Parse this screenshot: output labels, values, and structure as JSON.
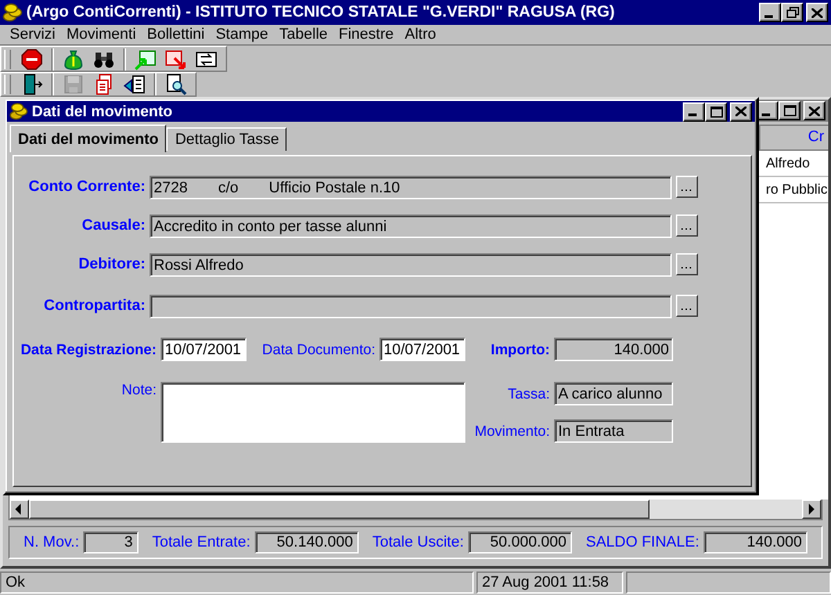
{
  "app_window": {
    "title": "(Argo ContiCorrenti) - ISTITUTO TECNICO STATALE \"G.VERDI\" RAGUSA (RG)"
  },
  "menu": [
    {
      "label": "Servizi"
    },
    {
      "label": "Movimenti"
    },
    {
      "label": "Bollettini"
    },
    {
      "label": "Stampe"
    },
    {
      "label": "Tabelle"
    },
    {
      "label": "Finestre"
    },
    {
      "label": "Altro"
    }
  ],
  "toolbars": [
    {
      "groups": [
        [
          {
            "kind": "stop",
            "disabled": false
          }
        ],
        [
          {
            "kind": "money",
            "disabled": false
          },
          {
            "kind": "binoculars",
            "disabled": false
          }
        ],
        [
          {
            "kind": "import",
            "disabled": false
          },
          {
            "kind": "export",
            "disabled": false
          },
          {
            "kind": "transfer",
            "disabled": false
          }
        ]
      ]
    },
    {
      "groups": [
        [
          {
            "kind": "exit",
            "disabled": false
          }
        ],
        [
          {
            "kind": "save",
            "disabled": true
          },
          {
            "kind": "stack",
            "disabled": false
          },
          {
            "kind": "sendpage",
            "disabled": false
          }
        ],
        [
          {
            "kind": "preview",
            "disabled": false
          }
        ]
      ]
    }
  ],
  "back_window": {
    "header": "Cr",
    "rows": [
      "Alfredo",
      "ro Pubblic"
    ],
    "totals": [
      {
        "label": "N. Mov.:",
        "value": "3"
      },
      {
        "label": "Totale Entrate:",
        "value": "50.140.000"
      },
      {
        "label": "Totale Uscite:",
        "value": "50.000.000"
      },
      {
        "label": "SALDO FINALE:",
        "value": "140.000"
      }
    ]
  },
  "dialog": {
    "title": "Dati del movimento",
    "tabs": [
      {
        "label": "Dati del movimento",
        "selected": true
      },
      {
        "label": "Dettaglio Tasse",
        "selected": false
      }
    ],
    "lookups": [
      {
        "label": "Conto Corrente:",
        "value_parts": [
          "2728",
          "c/o",
          "Ufficio Postale n.10"
        ]
      },
      {
        "label": "Causale:",
        "value_parts": [
          "Accredito in conto per tasse alunni"
        ]
      },
      {
        "label": "Debitore:",
        "value_parts": [
          "Rossi Alfredo"
        ]
      },
      {
        "label": "Contropartita:"
      }
    ],
    "data_registrazione": {
      "label": "Data Registrazione:",
      "value": "10/07/2001"
    },
    "data_documento": {
      "label": "Data Documento:",
      "value": "10/07/2001"
    },
    "importo": {
      "label": "Importo:",
      "value": "140.000"
    },
    "note": {
      "label": "Note:"
    },
    "tassa": {
      "label": "Tassa:",
      "value": "A carico alunno"
    },
    "movimento": {
      "label": "Movimento:",
      "value": "In Entrata"
    }
  },
  "status_bar": {
    "message": "Ok",
    "datetime": "27 Aug 2001 11:58"
  }
}
